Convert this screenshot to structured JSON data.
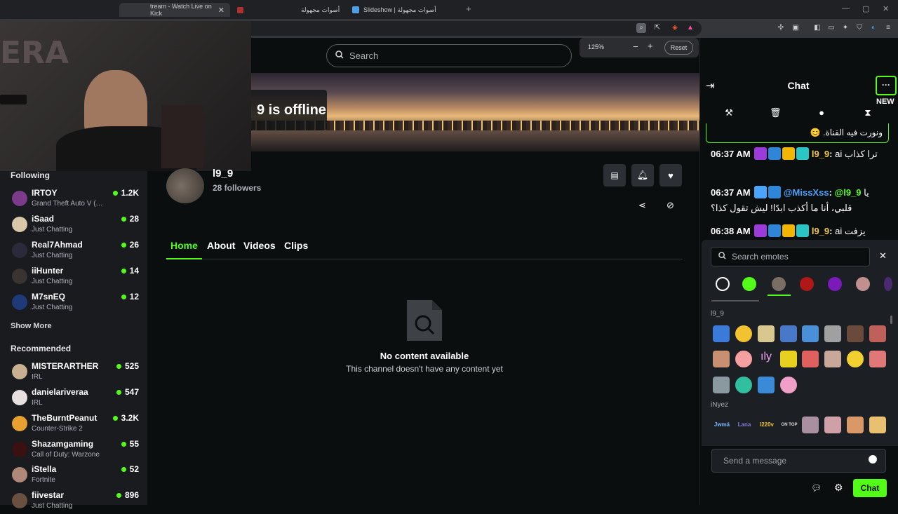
{
  "browser": {
    "tabs": [
      {
        "label": "tream - Watch Live on Kick"
      },
      {
        "label": "أصوات مجهولة"
      },
      {
        "label": "Slideshow | أصوات مجهولة"
      }
    ],
    "new_tab_icon": "plus-icon"
  },
  "topnav": {
    "search_placeholder": "Search",
    "zoom": {
      "level": "125%",
      "minus": "−",
      "plus": "+",
      "reset": "Reset"
    }
  },
  "sidebar": {
    "following_title": "Following",
    "following": [
      {
        "name": "IRTOY",
        "category": "Grand Theft Auto V (…",
        "viewers": "1.2K"
      },
      {
        "name": "iSaad",
        "category": "Just Chatting",
        "viewers": "28"
      },
      {
        "name": "Real7Ahmad",
        "category": "Just Chatting",
        "viewers": "26"
      },
      {
        "name": "iiHunter",
        "category": "Just Chatting",
        "viewers": "14"
      },
      {
        "name": "M7snEQ",
        "category": "Just Chatting",
        "viewers": "12"
      }
    ],
    "show_more": "Show More",
    "recommended_title": "Recommended",
    "recommended": [
      {
        "name": "MISTERARTHER",
        "category": "IRL",
        "viewers": "525"
      },
      {
        "name": "danielariveraa",
        "category": "IRL",
        "viewers": "547"
      },
      {
        "name": "TheBurntPeanut",
        "category": "Counter-Strike 2",
        "viewers": "3.2K"
      },
      {
        "name": "Shazamgaming",
        "category": "Call of Duty: Warzone",
        "viewers": "55"
      },
      {
        "name": "iStella",
        "category": "Fortnite",
        "viewers": "52"
      },
      {
        "name": "fiivestar",
        "category": "Just Chatting",
        "viewers": "896"
      }
    ]
  },
  "channel": {
    "offline_text": "9 is offline",
    "name": "l9_9",
    "followers": "28 followers",
    "tabs": [
      "Home",
      "About",
      "Videos",
      "Clips"
    ],
    "empty_title": "No content available",
    "empty_subtitle": "This channel doesn't have any content yet"
  },
  "chat": {
    "title": "Chat",
    "new_label": "NEW",
    "menu": "···",
    "pinned": "ونورت فيه القناة. 😊",
    "messages": [
      {
        "time": "06:37 AM",
        "user": "l9_9",
        "text": "ai ترا كذاب"
      },
      {
        "time": "06:37 AM",
        "user": "@MissXss",
        "reply_to": "@l9_9",
        "text": "يا قلبي، أنا ما أكذب ابدًا! ليش تقول كذا؟"
      },
      {
        "time": "06:38 AM",
        "user": "l9_9",
        "text": "ai يزفت"
      }
    ],
    "emote_search_placeholder": "Search emotes",
    "emote_groups": [
      "l9_9",
      "iNyez"
    ],
    "emote_text_labels": [
      "Jwmá",
      "Lana",
      "l220v",
      "ON TOP"
    ],
    "input_placeholder": "Send a message",
    "send_label": "Chat"
  },
  "colors": {
    "accent": "#53fc18",
    "background": "#0b0e0f",
    "sidebar": "#191b1f",
    "username_gold": "#f2c94c",
    "username_blue": "#4aa3ff"
  }
}
